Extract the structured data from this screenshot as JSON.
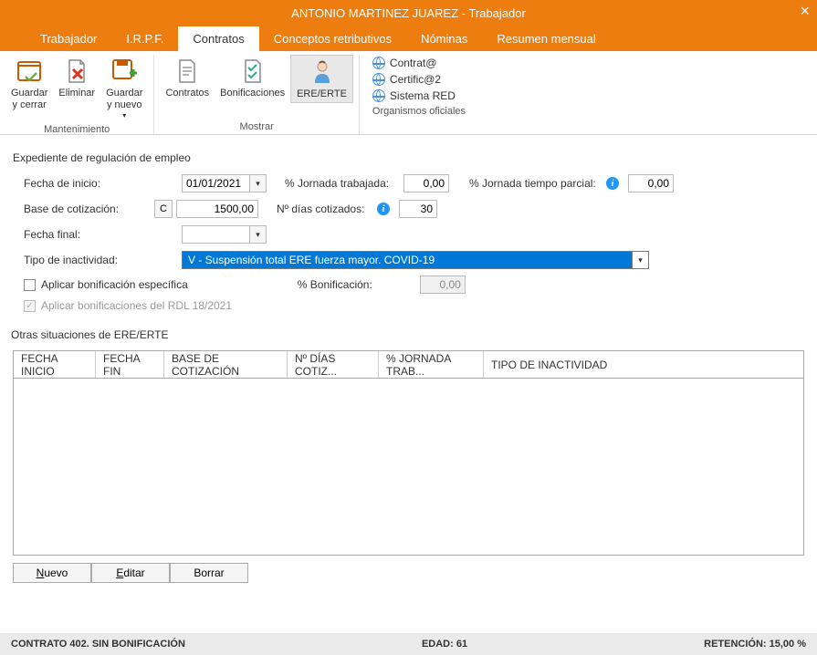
{
  "window": {
    "title": "ANTONIO MARTINEZ JUAREZ - Trabajador"
  },
  "tabs": {
    "items": [
      "Trabajador",
      "I.R.P.F.",
      "Contratos",
      "Conceptos retributivos",
      "Nóminas",
      "Resumen mensual"
    ],
    "active": 2
  },
  "ribbon": {
    "mantenimiento": {
      "label": "Mantenimiento",
      "guardar_cerrar": "Guardar\ny cerrar",
      "eliminar": "Eliminar",
      "guardar_nuevo": "Guardar\ny nuevo"
    },
    "mostrar": {
      "label": "Mostrar",
      "contratos": "Contratos",
      "bonificaciones": "Bonificaciones",
      "ere_erte": "ERE/ERTE"
    },
    "organismos": {
      "label": "Organismos oficiales",
      "contrata": "Contrat@",
      "certifica2": "Certific@2",
      "sistema_red": "Sistema RED"
    }
  },
  "form": {
    "section1_title": "Expediente de regulación de empleo",
    "fecha_inicio_label": "Fecha de inicio:",
    "fecha_inicio_value": "01/01/2021",
    "jornada_trabajada_label": "% Jornada trabajada:",
    "jornada_trabajada_value": "0,00",
    "jornada_parcial_label": "% Jornada tiempo parcial:",
    "jornada_parcial_value": "0,00",
    "base_cotizacion_label": "Base de cotización:",
    "base_cotizacion_btn": "C",
    "base_cotizacion_value": "1500,00",
    "dias_cotizados_label": "Nº días cotizados:",
    "dias_cotizados_value": "30",
    "fecha_final_label": "Fecha final:",
    "fecha_final_value": "",
    "tipo_inactividad_label": "Tipo de inactividad:",
    "tipo_inactividad_value": "V - Suspensión total ERE fuerza mayor. COVID-19",
    "aplicar_bonif_especifica": "Aplicar bonificación específica",
    "pct_bonificacion_label": "% Bonificación:",
    "pct_bonificacion_value": "0,00",
    "aplicar_bonif_rdl": "Aplicar bonificaciones del RDL 18/2021"
  },
  "table": {
    "section_title": "Otras situaciones de ERE/ERTE",
    "cols": [
      "FECHA INICIO",
      "FECHA FIN",
      "BASE DE COTIZACIÓN",
      "Nº DÍAS COTIZ...",
      "% JORNADA TRAB...",
      "TIPO DE INACTIVIDAD"
    ]
  },
  "buttons": {
    "nuevo": "Nuevo",
    "editar": "Editar",
    "borrar": "Borrar"
  },
  "status": {
    "contrato": "CONTRATO 402.  SIN BONIFICACIÓN",
    "edad": "EDAD: 61",
    "retencion": "RETENCIÓN: 15,00 %"
  }
}
